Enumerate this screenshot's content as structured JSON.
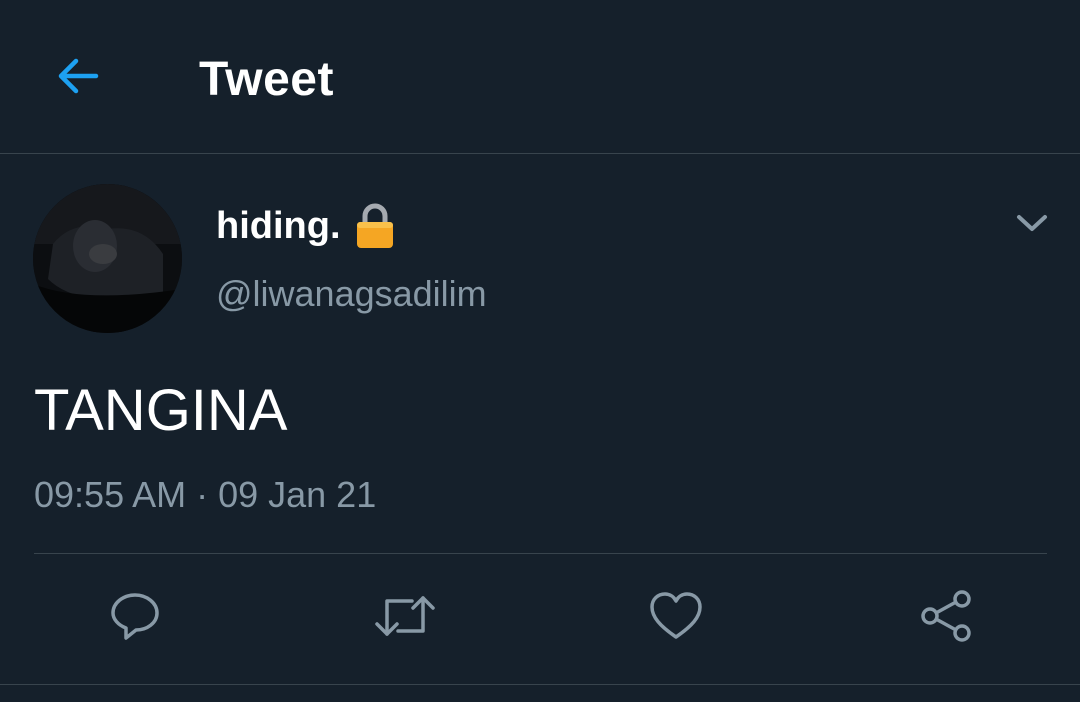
{
  "header": {
    "title": "Tweet",
    "back_icon": "arrow-left-icon"
  },
  "tweet": {
    "author": {
      "display_name": "hiding.",
      "handle": "@liwanagsadilim",
      "protected_icon": "lock-icon"
    },
    "text": "TANGINA",
    "timestamp": "09:55 AM · 09 Jan 21",
    "more_icon": "chevron-down-icon"
  },
  "actions": [
    {
      "name": "reply",
      "icon": "reply-icon"
    },
    {
      "name": "retweet",
      "icon": "retweet-icon"
    },
    {
      "name": "like",
      "icon": "heart-icon"
    },
    {
      "name": "share",
      "icon": "share-icon"
    }
  ],
  "colors": {
    "background": "#15202b",
    "accent": "#1da1f2",
    "secondary_text": "#8899a6",
    "divider": "#38444d",
    "lock": "#f5a623"
  }
}
